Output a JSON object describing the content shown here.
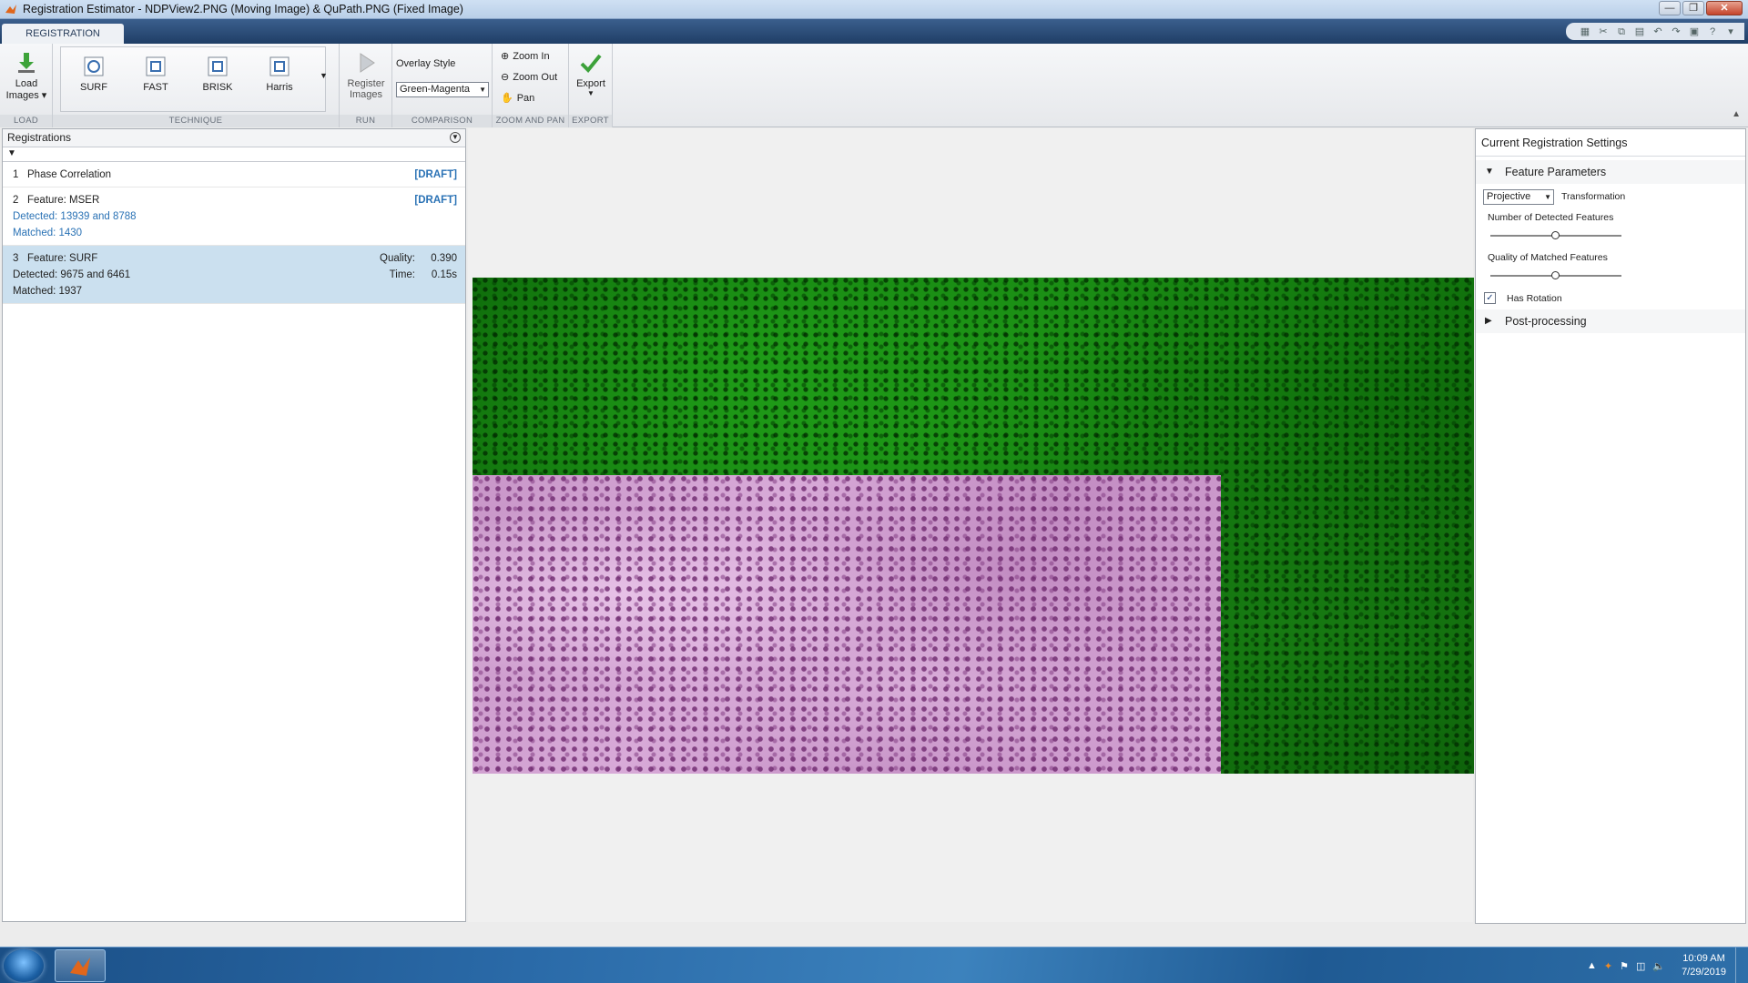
{
  "window": {
    "title": "Registration Estimator - NDPView2.PNG (Moving Image) & QuPath.PNG (Fixed Image)",
    "controls": [
      "minimize",
      "restore",
      "close"
    ]
  },
  "tabs": [
    {
      "label": "REGISTRATION"
    }
  ],
  "ribbon": {
    "load": {
      "button_line1": "Load",
      "button_line2": "Images",
      "section": "LOAD"
    },
    "technique": {
      "items": [
        "SURF",
        "FAST",
        "BRISK",
        "Harris"
      ],
      "section": "TECHNIQUE"
    },
    "run": {
      "button_line1": "Register",
      "button_line2": "Images",
      "section": "RUN"
    },
    "comparison": {
      "label": "Overlay Style",
      "selected": "Green-Magenta",
      "section": "COMPARISON"
    },
    "zoom": {
      "zoom_in": "Zoom In",
      "zoom_out": "Zoom Out",
      "pan": "Pan",
      "section": "ZOOM AND PAN"
    },
    "export": {
      "button": "Export",
      "section": "EXPORT"
    }
  },
  "registrations_panel": {
    "title": "Registrations",
    "items": [
      {
        "num": "1",
        "name": "Phase Correlation",
        "status": "[DRAFT]"
      },
      {
        "num": "2",
        "name": "Feature: MSER",
        "status": "[DRAFT]",
        "detected": "Detected: 13939 and 8788",
        "matched": "Matched: 1430"
      },
      {
        "num": "3",
        "name": "Feature: SURF",
        "detected": "Detected: 9675 and 6461",
        "matched": "Matched: 1937",
        "quality_label": "Quality:",
        "quality": "0.390",
        "time_label": "Time:",
        "time": "0.15s"
      }
    ]
  },
  "settings_panel": {
    "title": "Current Registration Settings",
    "feature_section": "Feature Parameters",
    "transformation_value": "Projective",
    "transformation_label": "Transformation",
    "detected_label": "Number of Detected Features",
    "detected_level": 0.5,
    "quality_label": "Quality of Matched Features",
    "quality_level": 0.5,
    "rotation_label": "Has Rotation",
    "rotation_checked": true,
    "post_section": "Post-processing"
  },
  "taskbar": {
    "time": "10:09 AM",
    "date": "7/29/2019"
  },
  "colors": {
    "accent_blue": "#2a72b5",
    "overlay_green": "#1a8c14",
    "overlay_magenta": "#d4a4d4"
  }
}
